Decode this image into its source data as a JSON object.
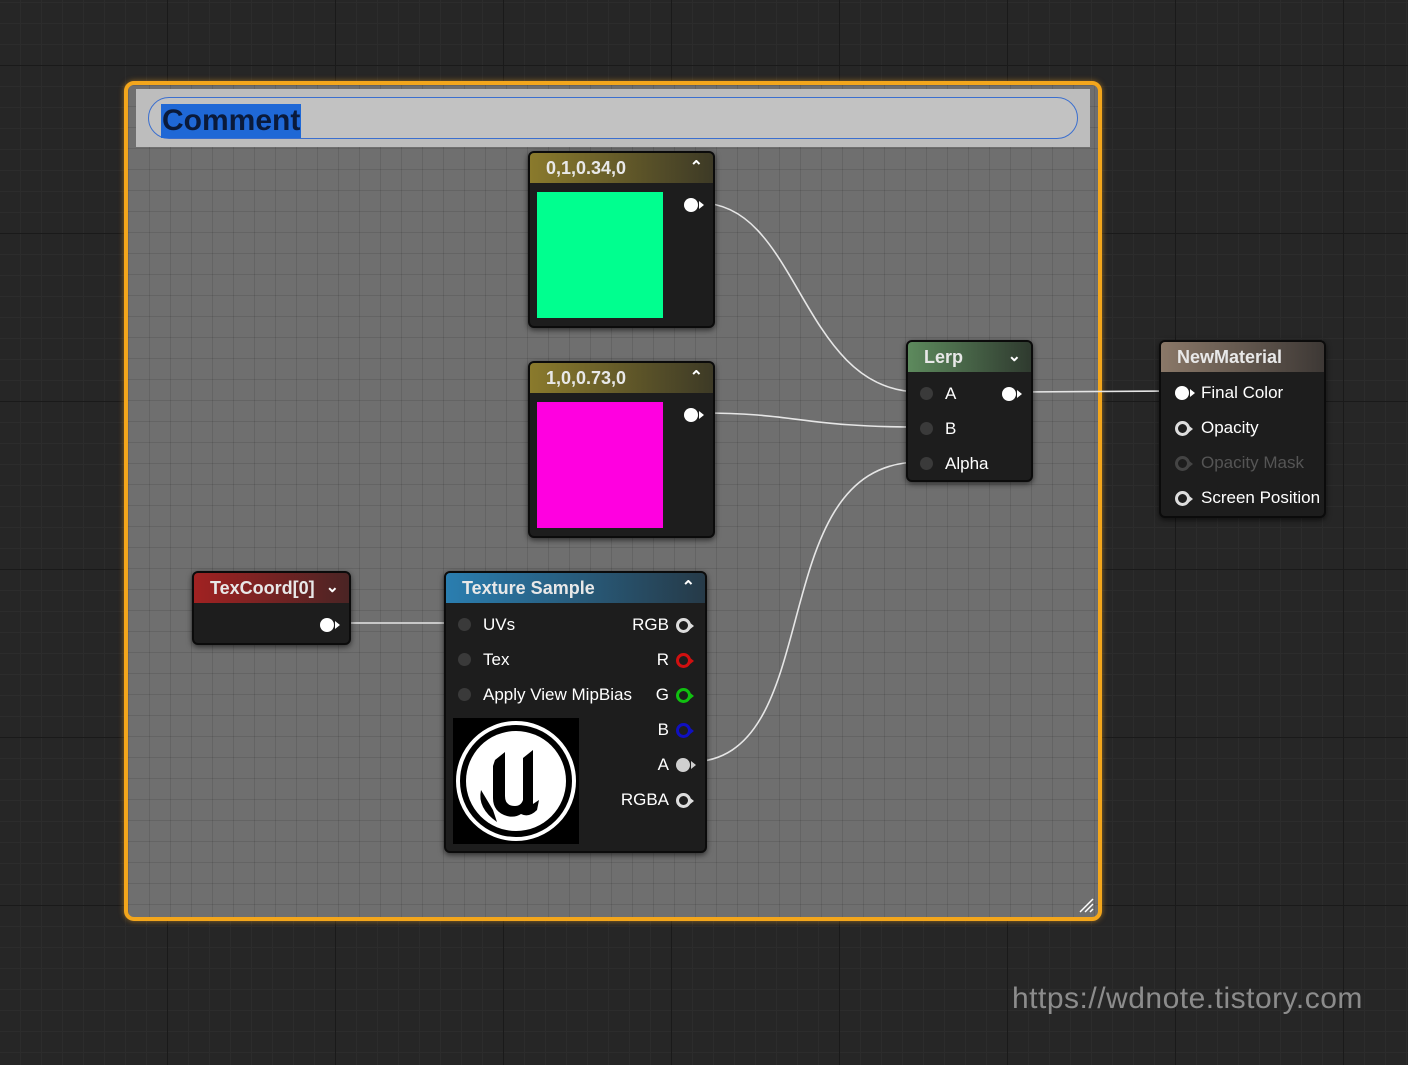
{
  "comment": {
    "title": "Comment"
  },
  "nodes": {
    "const_green": {
      "title": "0,1,0.34,0",
      "color": "#00ff8f"
    },
    "const_magenta": {
      "title": "1,0,0.73,0",
      "color": "#ff00e0"
    },
    "texcoord": {
      "title": "TexCoord[0]"
    },
    "texture_sample": {
      "title": "Texture Sample",
      "inputs": [
        "UVs",
        "Tex",
        "Apply View MipBias"
      ],
      "outputs": [
        "RGB",
        "R",
        "G",
        "B",
        "A",
        "RGBA"
      ]
    },
    "lerp": {
      "title": "Lerp",
      "inputs": [
        "A",
        "B",
        "Alpha"
      ]
    },
    "material": {
      "title": "NewMaterial",
      "inputs": [
        "Final Color",
        "Opacity",
        "Opacity Mask",
        "Screen Position"
      ]
    }
  },
  "watermark": "https://wdnote.tistory.com",
  "colors": {
    "comment_border": "#f3a61c",
    "selection": "#1f68d6",
    "pin_r": "#d01010",
    "pin_g": "#10c010",
    "pin_b": "#1010c0"
  },
  "icons": [
    "chevron-up-icon",
    "chevron-down-icon",
    "unreal-logo-icon",
    "resize-grip-icon"
  ]
}
